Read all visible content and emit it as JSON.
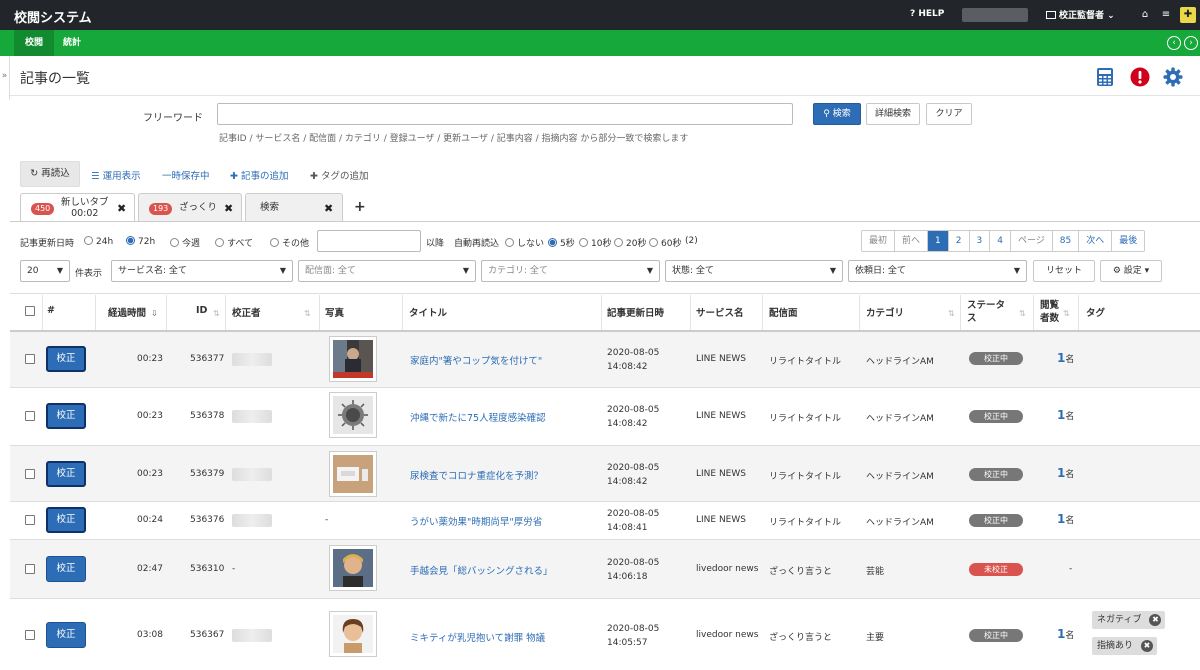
{
  "app": {
    "title": "校閲システム",
    "help": "HELP",
    "role": "校正監督者",
    "tabs": [
      "校閲",
      "統計"
    ]
  },
  "page": {
    "title": "記事の一覧"
  },
  "search": {
    "label": "フリーワード",
    "value": "",
    "search_button": "検索",
    "advanced_button": "詳細検索",
    "clear_button": "クリア",
    "hint": "記事ID / サービス名 / 配信面 / カテゴリ / 登録ユーザ / 更新ユーザ / 記事内容 / 指摘内容 から部分一致で検索します"
  },
  "toolbar": {
    "reload": "再読込",
    "ops_view": "運用表示",
    "temp_saved": "一時保存中",
    "add_article": "記事の追加",
    "add_tag": "タグの追加"
  },
  "tabs": [
    {
      "badge": "450",
      "label": "新しいタブ",
      "sub": "00:02",
      "close": "✖"
    },
    {
      "badge": "193",
      "label": "ざっくり",
      "sub": "",
      "close": "✖"
    },
    {
      "badge": "",
      "label": "検索",
      "sub": "",
      "close": "✖"
    }
  ],
  "add_tab": "+",
  "filters": {
    "updated_label": "記事更新日時",
    "updated_options": [
      "24h",
      "72h",
      "今週",
      "すべて",
      "その他"
    ],
    "updated_selected": "72h",
    "since_suffix": "以降",
    "auto_reload_label": "自動再読込",
    "auto_reload_options": [
      "しない",
      "5秒",
      "10秒",
      "20秒",
      "60秒"
    ],
    "auto_reload_selected": "5秒",
    "auto_reload_count": "(2)"
  },
  "pager": {
    "first": "最初",
    "prev": "前へ",
    "pages": [
      "1",
      "2",
      "3",
      "4"
    ],
    "current": "1",
    "page_label": "ページ",
    "last_page": "85",
    "next": "次へ",
    "last": "最後"
  },
  "selects": {
    "per_page": "20",
    "per_page_suffix": "件表示",
    "service": "サービス名: 全て",
    "channel": "配信面: 全て",
    "category": "カテゴリ: 全て",
    "state": "状態: 全て",
    "request_date": "依頼日: 全て",
    "reset": "リセット",
    "settings": "設定"
  },
  "table": {
    "headers": {
      "num": "#",
      "elapsed": "経過時間",
      "id": "ID",
      "proofreader": "校正者",
      "photo": "写真",
      "title": "タイトル",
      "updated": "記事更新日時",
      "service": "サービス名",
      "channel": "配信面",
      "category": "カテゴリ",
      "status_1": "ステータ",
      "status_2": "ス",
      "viewers_1": "閲覧",
      "viewers_2": "者数",
      "tag": "タグ"
    },
    "rows": [
      {
        "btn": "校正",
        "elapsed": "00:23",
        "id": "536377",
        "photo": "yes",
        "title": "家庭内\"箸やコップ気を付けて\"",
        "date": "2020-08-05",
        "time": "14:08:42",
        "service": "LINE NEWS",
        "channel": "リライトタイトル",
        "category": "ヘッドラインAM",
        "status": "校正中",
        "count": "1",
        "unit": "名"
      },
      {
        "btn": "校正",
        "elapsed": "00:23",
        "id": "536378",
        "photo": "yes",
        "title": "沖縄で新たに75人程度感染確認",
        "date": "2020-08-05",
        "time": "14:08:42",
        "service": "LINE NEWS",
        "channel": "リライトタイトル",
        "category": "ヘッドラインAM",
        "status": "校正中",
        "count": "1",
        "unit": "名"
      },
      {
        "btn": "校正",
        "elapsed": "00:23",
        "id": "536379",
        "photo": "yes",
        "title": "尿検査でコロナ重症化を予測？",
        "date": "2020-08-05",
        "time": "14:08:42",
        "service": "LINE NEWS",
        "channel": "リライトタイトル",
        "category": "ヘッドラインAM",
        "status": "校正中",
        "count": "1",
        "unit": "名"
      },
      {
        "btn": "校正",
        "elapsed": "00:24",
        "id": "536376",
        "photo": "-",
        "title": "うがい薬効果\"時期尚早\"厚労省",
        "date": "2020-08-05",
        "time": "14:08:41",
        "service": "LINE NEWS",
        "channel": "リライトタイトル",
        "category": "ヘッドラインAM",
        "status": "校正中",
        "count": "1",
        "unit": "名"
      },
      {
        "btn": "校正",
        "elapsed": "02:47",
        "id": "536310",
        "proofreader": "-",
        "photo": "yes",
        "title": "手越会見「総バッシングされる」",
        "date": "2020-08-05",
        "time": "14:06:18",
        "service": "livedoor news",
        "channel": "ざっくり言うと",
        "category": "芸能",
        "status": "未校正",
        "count": "-",
        "unit": ""
      },
      {
        "btn": "校正",
        "elapsed": "03:08",
        "id": "536367",
        "photo": "yes",
        "title": "ミキティが乳児抱いて謝罪 物議",
        "date": "2020-08-05",
        "time": "14:05:57",
        "service": "livedoor news",
        "channel": "ざっくり言うと",
        "category": "主要",
        "status": "校正中",
        "count": "1",
        "unit": "名",
        "tags": [
          "ネガティブ",
          "指摘あり"
        ]
      }
    ]
  },
  "colors": {
    "topbar": "#222529",
    "green": "#17a83b",
    "primary": "#2d6db5",
    "danger": "#d9534f",
    "status_gray": "#777777"
  }
}
